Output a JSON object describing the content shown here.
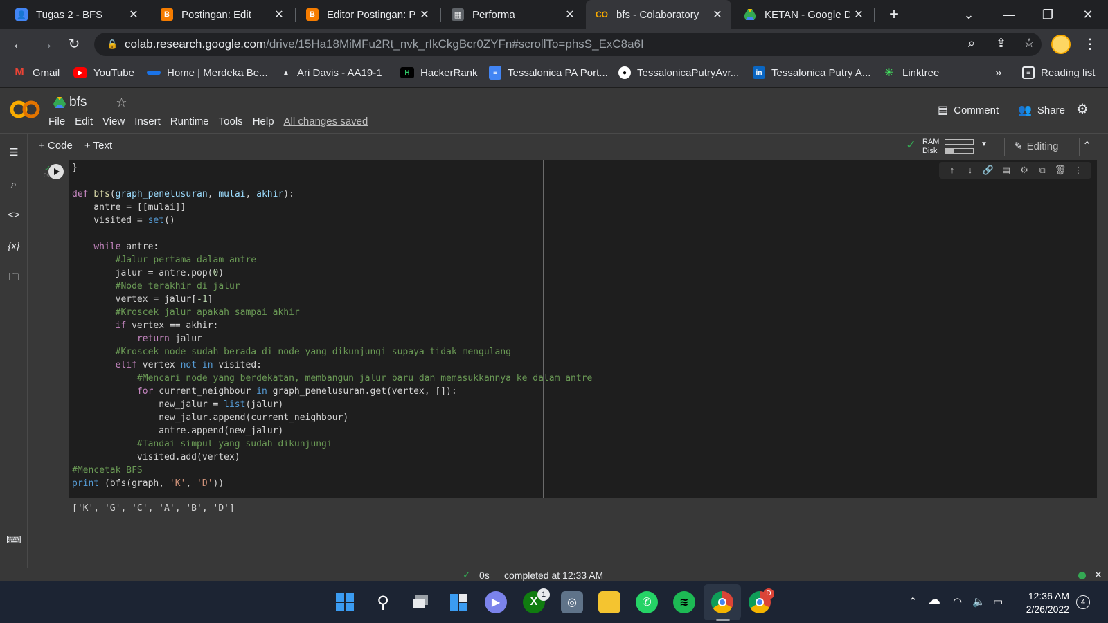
{
  "browser": {
    "tabs": [
      {
        "title": "Tugas 2 - BFS",
        "icon": "person-icon",
        "color": "#4285f4"
      },
      {
        "title": "Postingan: Edit",
        "icon": "blogger-icon",
        "color": "#f57c00"
      },
      {
        "title": "Editor Postingan: P",
        "icon": "blogger-icon",
        "color": "#f57c00"
      },
      {
        "title": "Performa",
        "icon": "dashboard-icon",
        "color": "#5f6368"
      },
      {
        "title": "bfs - Colaboratory",
        "icon": "colab-icon",
        "color": "#f9ab00",
        "active": true
      },
      {
        "title": "KETAN - Google Dr",
        "icon": "drive-icon",
        "color": "#34a853"
      }
    ],
    "close_glyph": "✕",
    "new_tab_glyph": "+",
    "url_host": "colab.research.google.com",
    "url_path": "/drive/15Ha18MiMFu2Rt_nvk_rIkCkgBcr0ZYFn#scrollTo=phsS_ExC8a6I",
    "bookmarks": [
      {
        "label": "Gmail",
        "icon": "gmail-icon",
        "color": "#ea4335"
      },
      {
        "label": "YouTube",
        "icon": "youtube-icon",
        "color": "#ff0000"
      },
      {
        "label": "Home | Merdeka Be...",
        "icon": "merdeka-icon",
        "color": "#1a73e8"
      },
      {
        "label": "Ari Davis - AA19-1",
        "icon": "triangle-icon",
        "color": "#202124"
      },
      {
        "label": "HackerRank",
        "icon": "hackerrank-icon",
        "color": "#000000"
      },
      {
        "label": "Tessalonica PA Port...",
        "icon": "docs-icon",
        "color": "#4285f4"
      },
      {
        "label": "TessalonicaPutryAvr...",
        "icon": "github-icon",
        "color": "#ffffff"
      },
      {
        "label": "Tessalonica Putry A...",
        "icon": "linkedin-icon",
        "color": "#0a66c2"
      },
      {
        "label": "Linktree",
        "icon": "linktree-icon",
        "color": "#43e660"
      }
    ],
    "bookmarks_overflow": "»",
    "reading_list": "Reading list"
  },
  "colab": {
    "notebook_name": "bfs",
    "menu": [
      "File",
      "Edit",
      "View",
      "Insert",
      "Runtime",
      "Tools",
      "Help"
    ],
    "save_status": "All changes saved",
    "comment_label": "Comment",
    "share_label": "Share",
    "add_code": "+ Code",
    "add_text": "+ Text",
    "ram_label": "RAM",
    "disk_label": "Disk",
    "editing_label": "Editing",
    "exec_time": "0s",
    "code_lines": [
      "}",
      "",
      "def bfs(graph_penelusuran, mulai, akhir):",
      "    antre = [[mulai]]",
      "    visited = set()",
      "",
      "    while antre:",
      "        #Jalur pertama dalam antre",
      "        jalur = antre.pop(0)",
      "        #Node terakhir di jalur",
      "        vertex = jalur[-1]",
      "        #Kroscek jalur apakah sampai akhir",
      "        if vertex == akhir:",
      "            return jalur",
      "        #Kroscek node sudah berada di node yang dikunjungi supaya tidak mengulang",
      "        elif vertex not in visited:",
      "            #Mencari node yang berdekatan, membangun jalur baru dan memasukkannya ke dalam antre",
      "            for current_neighbour in graph_penelusuran.get(vertex, []):",
      "                new_jalur = list(jalur)",
      "                new_jalur.append(current_neighbour)",
      "                antre.append(new_jalur)",
      "            #Tandai simpul yang sudah dikunjungi",
      "            visited.add(vertex)",
      "#Mencetak BFS",
      "print (bfs(graph, 'K', 'D'))"
    ],
    "output": "['K', 'G', 'C', 'A', 'B', 'D']",
    "status_time": "0s",
    "status_text": "completed at 12:33 AM"
  },
  "taskbar": {
    "apps": [
      {
        "name": "start-icon",
        "color": "#3b9cf2"
      },
      {
        "name": "search-icon",
        "color": "#1c2433"
      },
      {
        "name": "task-view-icon",
        "color": "#1c2433"
      },
      {
        "name": "widgets-icon",
        "color": "#1c2433"
      },
      {
        "name": "teams-chat-icon",
        "color": "#7b83eb"
      },
      {
        "name": "xbox-icon",
        "color": "#107c10",
        "badge": "1"
      },
      {
        "name": "app-icon",
        "color": "#5f7389"
      },
      {
        "name": "file-explorer-icon",
        "color": "#f4c430"
      },
      {
        "name": "whatsapp-icon",
        "color": "#25d366"
      },
      {
        "name": "spotify-icon",
        "color": "#1db954"
      },
      {
        "name": "chrome-icon",
        "color": "#4285f4"
      },
      {
        "name": "chrome-profile-icon",
        "color": "#db4437",
        "badge": "D"
      }
    ],
    "time": "12:36 AM",
    "date": "2/26/2022",
    "notification_count": "4"
  }
}
